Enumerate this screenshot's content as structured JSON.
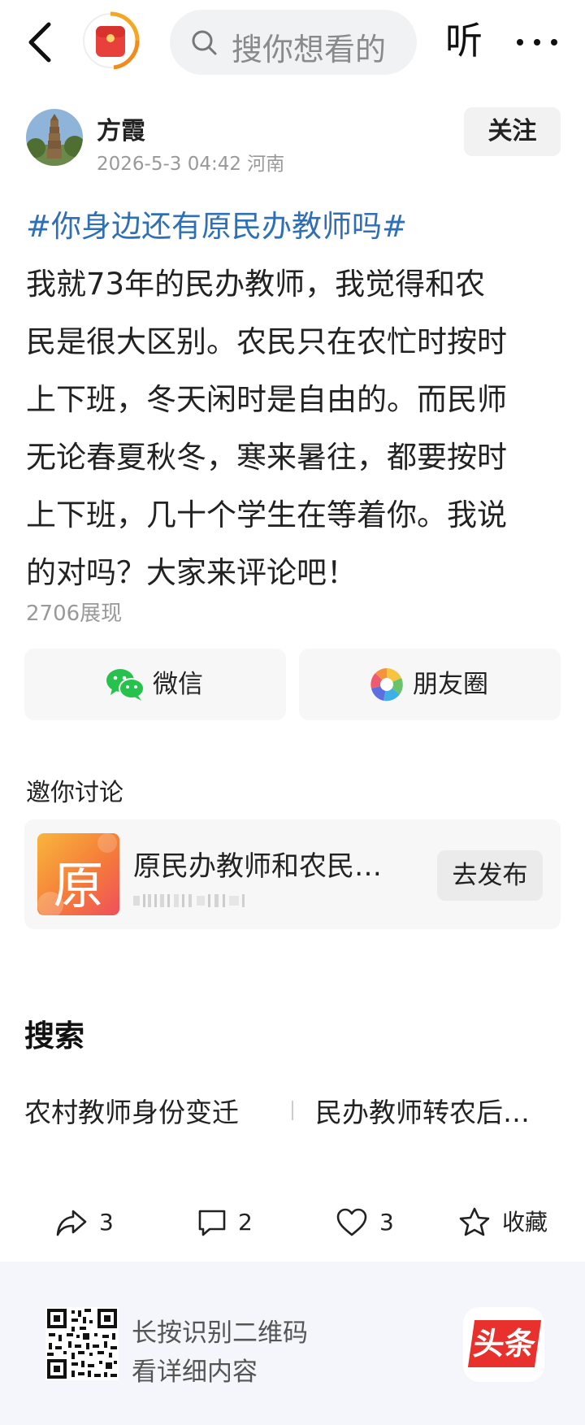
{
  "topbar": {
    "search_placeholder": "搜你想看的",
    "listen_label": "听",
    "icons": {
      "back": "back-chevron-icon",
      "app": "toutiao-red-packet-icon",
      "search": "search-icon",
      "more": "more-dots-icon"
    }
  },
  "author": {
    "name": "方霞",
    "meta": "2026-5-3 04:42 河南",
    "follow_label": "关注"
  },
  "post": {
    "hashtag": "#你身边还有原民办教师吗#",
    "lines": [
      "我就73年的民办教师，我觉得和农",
      "民是很大区别。农民只在农忙时按时",
      "上下班，冬天闲时是自由的。而民师",
      "无论春夏秋冬，寒来暑往，都要按时",
      "上下班，几十个学生在等着你。我说",
      "的对吗？大家来评论吧！"
    ],
    "views": "2706展现"
  },
  "share": {
    "wechat_label": "微信",
    "moments_label": "朋友圈",
    "colors": {
      "wechat": "#27c24c"
    }
  },
  "invite": {
    "title": "邀你讨论",
    "topic_char": "原",
    "topic_title": "原民办教师和农民…",
    "publish_label": "去发布"
  },
  "search": {
    "title": "搜索",
    "suggestions": [
      "农村教师身份变迁",
      "民办教师转农后…"
    ]
  },
  "actions": {
    "share_count": "3",
    "comment_count": "2",
    "like_count": "3",
    "favorite_label": "收藏"
  },
  "footer": {
    "line1": "长按识别二维码",
    "line2": "看详细内容",
    "brand": "头条",
    "brand_color": "#e8312c"
  }
}
